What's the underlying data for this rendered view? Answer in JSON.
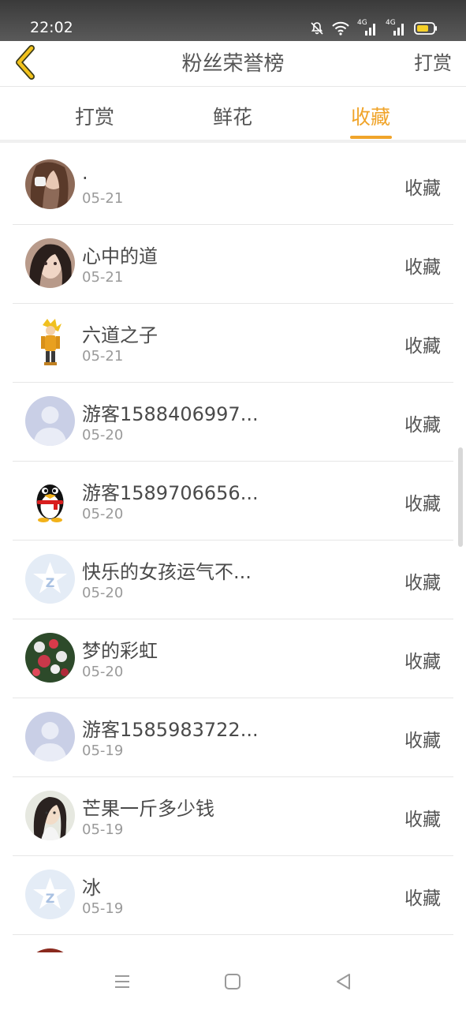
{
  "status": {
    "time": "22:02",
    "network1": "4G",
    "network2": "4G",
    "icons": [
      "mute-icon",
      "wifi-icon",
      "signal-icon",
      "signal-icon",
      "battery-icon"
    ]
  },
  "header": {
    "title": "粉丝荣誉榜",
    "right_link": "打赏"
  },
  "tabs": [
    {
      "label": "打赏",
      "active": false
    },
    {
      "label": "鲜花",
      "active": false
    },
    {
      "label": "收藏",
      "active": true
    }
  ],
  "accent_color": "#f0a42a",
  "list": [
    {
      "name": ".",
      "date": "05-21",
      "action": "收藏",
      "avatar": "photo-woman"
    },
    {
      "name": "心中的道",
      "date": "05-21",
      "action": "收藏",
      "avatar": "photo-woman"
    },
    {
      "name": "六道之子",
      "date": "05-21",
      "action": "收藏",
      "avatar": "anime-character"
    },
    {
      "name": "游客1588406997...",
      "date": "05-20",
      "action": "收藏",
      "avatar": "default-person"
    },
    {
      "name": "游客1589706656...",
      "date": "05-20",
      "action": "收藏",
      "avatar": "penguin"
    },
    {
      "name": "快乐的女孩运气不...",
      "date": "05-20",
      "action": "收藏",
      "avatar": "star-z"
    },
    {
      "name": "梦的彩虹",
      "date": "05-20",
      "action": "收藏",
      "avatar": "photo-flowers"
    },
    {
      "name": "游客1585983722...",
      "date": "05-19",
      "action": "收藏",
      "avatar": "default-person"
    },
    {
      "name": "芒果一斤多少钱",
      "date": "05-19",
      "action": "收藏",
      "avatar": "photo-woman"
    },
    {
      "name": "冰",
      "date": "05-19",
      "action": "收藏",
      "avatar": "star-z"
    }
  ],
  "nav": {
    "icons": [
      "menu-icon",
      "home-square-icon",
      "back-triangle-icon"
    ]
  }
}
